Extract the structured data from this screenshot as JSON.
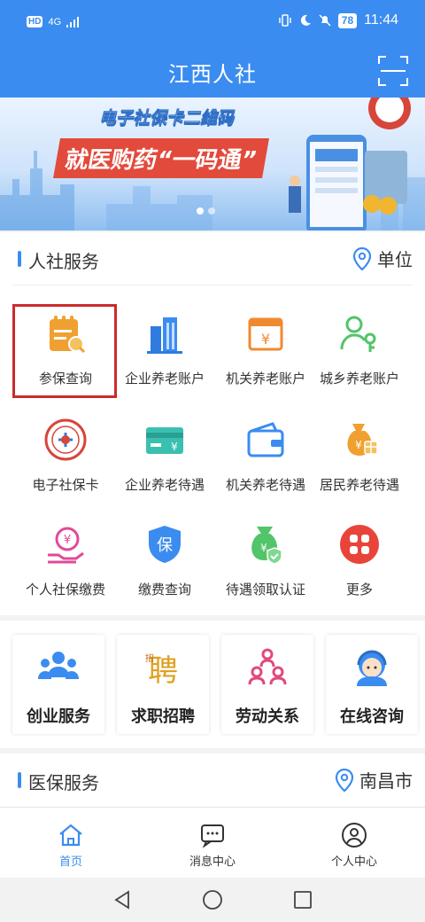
{
  "status_bar": {
    "left_badge": "HD",
    "network": "4G",
    "battery": "78",
    "time": "11:44"
  },
  "header": {
    "title": "江西人社"
  },
  "banner": {
    "line1": "电子社保卡二维码",
    "line2": "就医购药“一码通”"
  },
  "hr_section": {
    "title": "人社服务",
    "right_label": "单位",
    "items": [
      {
        "label": "参保查询",
        "icon": "calendar-search-icon"
      },
      {
        "label": "企业养老账户",
        "icon": "buildings-icon"
      },
      {
        "label": "机关养老账户",
        "icon": "yuan-cash-register-icon"
      },
      {
        "label": "城乡养老账户",
        "icon": "person-key-icon"
      },
      {
        "label": "电子社保卡",
        "icon": "social-security-seal-icon"
      },
      {
        "label": "企业养老待遇",
        "icon": "yuan-card-icon"
      },
      {
        "label": "机关养老待遇",
        "icon": "wallet-icon"
      },
      {
        "label": "居民养老待遇",
        "icon": "money-bag-gift-icon"
      },
      {
        "label": "个人社保缴费",
        "icon": "hand-yuan-icon"
      },
      {
        "label": "缴费查询",
        "icon": "shield-bao-icon"
      },
      {
        "label": "待遇领取认证",
        "icon": "money-bag-shield-icon"
      },
      {
        "label": "更多",
        "icon": "more-grid-icon"
      }
    ]
  },
  "quick_links": [
    {
      "label": "创业服务",
      "icon": "team-icon"
    },
    {
      "label": "求职招聘",
      "icon": "recruit-icon"
    },
    {
      "label": "劳动关系",
      "icon": "people-network-icon"
    },
    {
      "label": "在线咨询",
      "icon": "customer-service-icon"
    }
  ],
  "medical_section": {
    "title": "医保服务",
    "right_label": "南昌市"
  },
  "tabbar": {
    "tabs": [
      {
        "label": "首页",
        "icon": "home-icon"
      },
      {
        "label": "消息中心",
        "icon": "message-icon"
      },
      {
        "label": "个人中心",
        "icon": "person-icon"
      }
    ]
  },
  "colors": {
    "primary": "#3b8cf0",
    "highlight_box": "#cc2b2b",
    "orange": "#f0a030",
    "green": "#52c46a",
    "red": "#e8443a"
  }
}
